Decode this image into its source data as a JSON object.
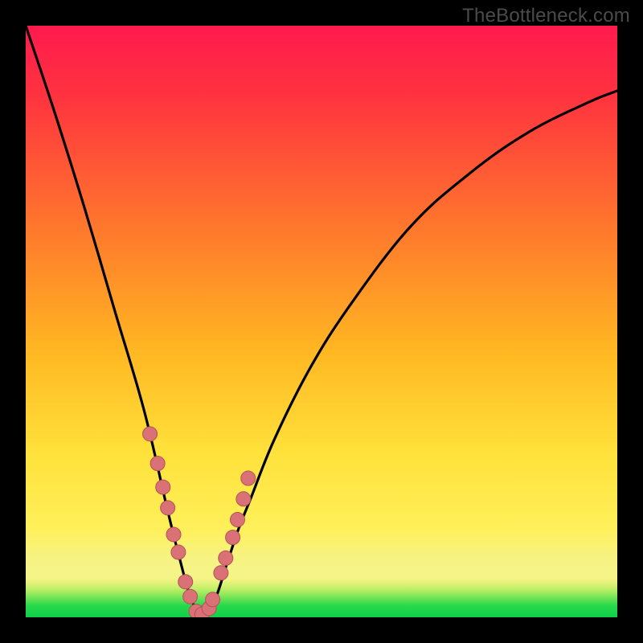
{
  "watermark": "TheBottleneck.com",
  "chart_data": {
    "type": "line",
    "title": "",
    "xlabel": "",
    "ylabel": "",
    "xlim": [
      0,
      100
    ],
    "ylim": [
      0,
      100
    ],
    "grid": false,
    "legend": false,
    "note": "Bottleneck curve. X ≈ relative hardware balance (0–100). Y ≈ bottleneck amount (%). Valley at x≈30 is the balanced point (0% bottleneck). Values estimated from pixel positions; no axis tick labels are shown in the image.",
    "series": [
      {
        "name": "bottleneck-curve",
        "x": [
          0,
          5,
          10,
          15,
          20,
          24,
          26,
          28,
          30,
          32,
          34,
          36,
          38,
          42,
          48,
          55,
          65,
          75,
          85,
          95,
          100
        ],
        "y": [
          100,
          85,
          69,
          52,
          35,
          18,
          10,
          3,
          0,
          3,
          9,
          15,
          20,
          30,
          42,
          53,
          66,
          75,
          82,
          87,
          89
        ]
      }
    ],
    "markers": {
      "name": "sample-points",
      "color": "#d96b72",
      "note": "Pink dots clustered near the valley on both arms of the V.",
      "x": [
        21.0,
        22.3,
        23.2,
        24.0,
        25.0,
        25.8,
        27.0,
        27.8,
        28.8,
        29.8,
        31.0,
        31.6,
        33.0,
        33.8,
        35.0,
        35.8,
        36.8,
        37.6
      ],
      "y": [
        31.0,
        26.0,
        22.0,
        18.5,
        14.0,
        11.0,
        6.0,
        3.5,
        1.0,
        0.5,
        1.5,
        3.0,
        7.5,
        10.0,
        13.5,
        16.5,
        20.0,
        23.5
      ]
    },
    "bands": [
      {
        "name": "green-band",
        "y0": 0,
        "y1": 2,
        "color": "#0fd64b"
      },
      {
        "name": "green-fade",
        "y0": 2,
        "y1": 6,
        "color": "gradient green→yellow"
      },
      {
        "name": "yellow-band",
        "y0": 6,
        "y1": 15,
        "color": "#f6f383"
      },
      {
        "name": "main-grad",
        "y0": 15,
        "y1": 100,
        "color": "gradient yellow→red"
      }
    ]
  },
  "colors": {
    "frame": "#000000",
    "grad_red_top": "#ff1a4e",
    "grad_red": "#ff3b3e",
    "grad_orange": "#ff8a2a",
    "grad_amber": "#ffc321",
    "grad_yellow": "#ffe83a",
    "grad_pale_yellow": "#f6f383",
    "grad_lime": "#a9ee5a",
    "grad_green": "#0fd64b",
    "curve": "#000000",
    "marker_fill": "#da7177",
    "marker_stroke": "#b15257",
    "watermark": "#4b4b4b"
  }
}
